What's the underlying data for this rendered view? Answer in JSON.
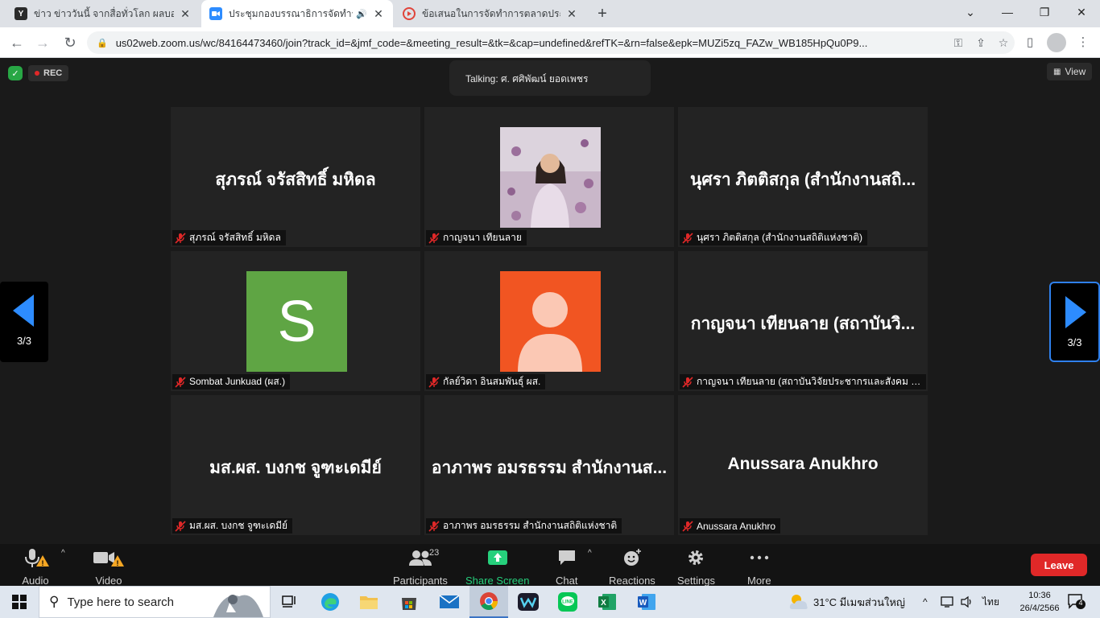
{
  "browser": {
    "tabs": [
      {
        "title": "ข่าว ข่าววันนี้ จากสื่อทั่วโลก ผลบอลโลก",
        "active": false,
        "favicon_color": "#2b2b2b",
        "favicon_letter": "Y"
      },
      {
        "title": "ประชุมกองบรรณาธิการจัดทำราย",
        "active": true,
        "favicon_color": "#2d8cff",
        "favicon_letter": "",
        "audio": "🔊"
      },
      {
        "title": "ข้อเสนอในการจัดทำการตลาดประมาณปี",
        "active": false,
        "favicon_color": "#e0443a",
        "favicon_letter": ""
      }
    ],
    "new_tab_label": "+",
    "url": "us02web.zoom.us/wc/84164473460/join?track_id=&jmf_code=&meeting_result=&tk=&cap=undefined&refTK=&rn=false&epk=MUZi5zq_FAZw_WB185HpQu0P9..."
  },
  "meeting": {
    "rec_label": "REC",
    "talking": "Talking: ศ. ศศิพัฒน์ ยอดเพชร",
    "view_label": "View",
    "page_indicator": "3/3",
    "tiles": [
      {
        "big": "สุภรณ์ จรัสสิทธิ์ มหิดล",
        "name": "สุภรณ์ จรัสสิทธิ์ มหิดล",
        "avatar": "none"
      },
      {
        "big": "",
        "name": "กาญจนา เทียนลาย",
        "avatar": "photo"
      },
      {
        "big": "นุศรา ภิตติสกุล (สำนักงานสถิ...",
        "name": "นุศรา ภิตติสกุล (สำนักงานสถิติแห่งชาติ)",
        "avatar": "none"
      },
      {
        "big": "",
        "name": "Sombat Junkuad (ผส.)",
        "avatar": "letter",
        "letter": "S"
      },
      {
        "big": "",
        "name": "กัลย์วิดา อินสมพันธุ์ ผส.",
        "avatar": "person"
      },
      {
        "big": "กาญจนา เทียนลาย (สถาบันวิ...",
        "name": "กาญจนา เทียนลาย (สถาบันวิจัยประชากรและสังคม ม.มหิ...",
        "avatar": "none"
      },
      {
        "big": "มส.ผส. บงกช จูฑะเดมีย์",
        "name": "มส.ผส. บงกช จูฑะเดมีย์",
        "avatar": "none"
      },
      {
        "big": "อาภาพร อมรธรรม สำนักงานส...",
        "name": "อาภาพร อมรธรรม สำนักงานสถิติแห่งชาติ",
        "avatar": "none"
      },
      {
        "big": "Anussara Anukhro",
        "name": "Anussara Anukhro",
        "avatar": "none"
      }
    ]
  },
  "controls": {
    "audio": "Audio",
    "video": "Video",
    "participants": "Participants",
    "participants_count": "23",
    "share_screen": "Share Screen",
    "chat": "Chat",
    "reactions": "Reactions",
    "settings": "Settings",
    "more": "More",
    "leave": "Leave"
  },
  "taskbar": {
    "search_placeholder": "Type here to search",
    "weather": "31°C  มีเมฆส่วนใหญ่",
    "lang": "ไทย",
    "time": "10:36",
    "date": "26/4/2566",
    "notifications": "4"
  },
  "colors": {
    "zoom_blue": "#2d8cff",
    "share_green": "#26d07c",
    "leave_red": "#e02828",
    "mute_red": "#e02828"
  }
}
